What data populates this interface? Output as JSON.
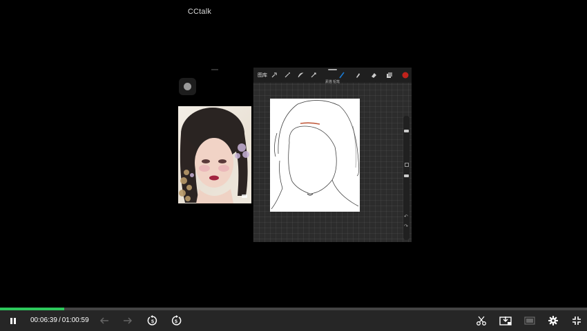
{
  "app": {
    "title": "CCtalk"
  },
  "procreate": {
    "gallery_label": "图库",
    "brush_info": "素描 铅笔",
    "accent_color": "#1a7bd4",
    "color_swatch": "#c0221b"
  },
  "player": {
    "current_time": "00:06:39",
    "separator": "/",
    "total_time": "01:00:59",
    "progress": 0.109,
    "progress_color": "#2ec95c"
  },
  "icons": {
    "pause": "pause-icon",
    "back": "arrow-left-icon",
    "forward": "arrow-right-icon",
    "rewind5": "rewind-5-icon",
    "forward5": "forward-5-icon",
    "clip": "scissors-icon",
    "export": "screen-download-icon",
    "pip": "picture-in-picture-icon",
    "settings": "gear-icon",
    "exit_fullscreen": "exit-fullscreen-icon"
  }
}
